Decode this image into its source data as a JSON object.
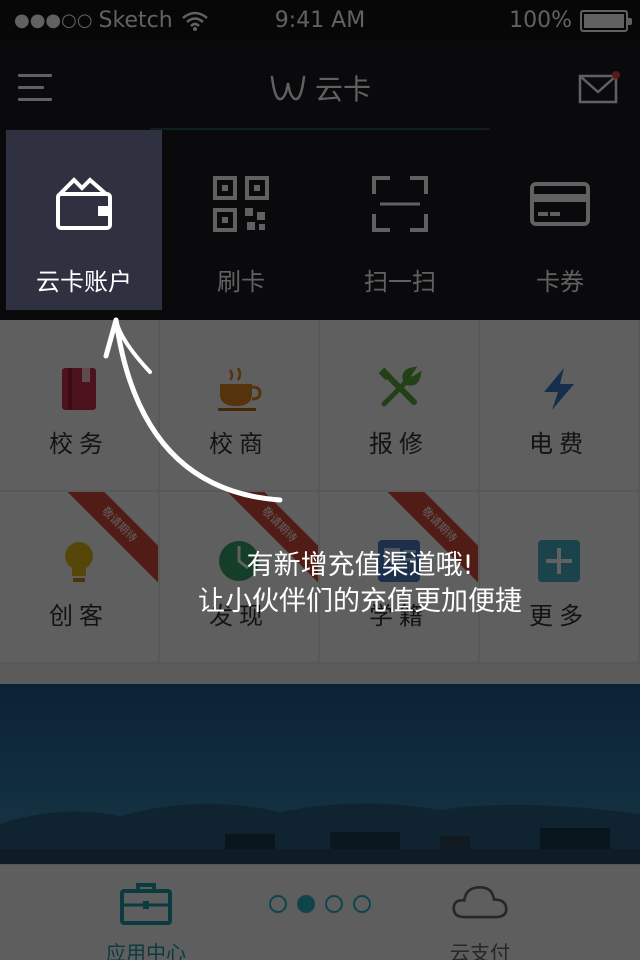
{
  "status_bar": {
    "carrier": "Sketch",
    "time": "9:41 AM",
    "battery": "100%"
  },
  "nav": {
    "title": "云卡"
  },
  "tabs": [
    {
      "label": "云卡账户",
      "icon": "wallet-icon"
    },
    {
      "label": "刷卡",
      "icon": "qrcode-icon"
    },
    {
      "label": "扫一扫",
      "icon": "scan-icon"
    },
    {
      "label": "卡券",
      "icon": "card-icon"
    }
  ],
  "grid": [
    {
      "label": "校务",
      "icon": "book-icon",
      "color": "#c8344a"
    },
    {
      "label": "校商",
      "icon": "coffee-cup-icon",
      "color": "#e08a22"
    },
    {
      "label": "报修",
      "icon": "tools-icon",
      "color": "#5bab3e"
    },
    {
      "label": "电费",
      "icon": "lightning-icon",
      "color": "#3a79c4"
    },
    {
      "label": "创客",
      "icon": "lightbulb-icon",
      "color": "#e4b818",
      "ribbon": "敬请期待"
    },
    {
      "label": "发现",
      "icon": "compass-icon",
      "color": "#35a36a",
      "ribbon": "敬请期待"
    },
    {
      "label": "学籍",
      "icon": "id-icon",
      "color": "#4a7fc4",
      "ribbon": "敬请期待"
    },
    {
      "label": "更多",
      "icon": "plus-icon",
      "color": "#44b0c4"
    }
  ],
  "tip": {
    "line1": "有新增充值渠道哦!",
    "line2": "让小伙伴们的充值更加便捷"
  },
  "bottom": {
    "left_label": "应用中心",
    "right_label": "云支付",
    "pager": {
      "count": 4,
      "active": 2
    }
  },
  "colors": {
    "accent": "#2bb3c9",
    "highlight": "#4b4c6b",
    "ribbon": "#d44a3a"
  }
}
